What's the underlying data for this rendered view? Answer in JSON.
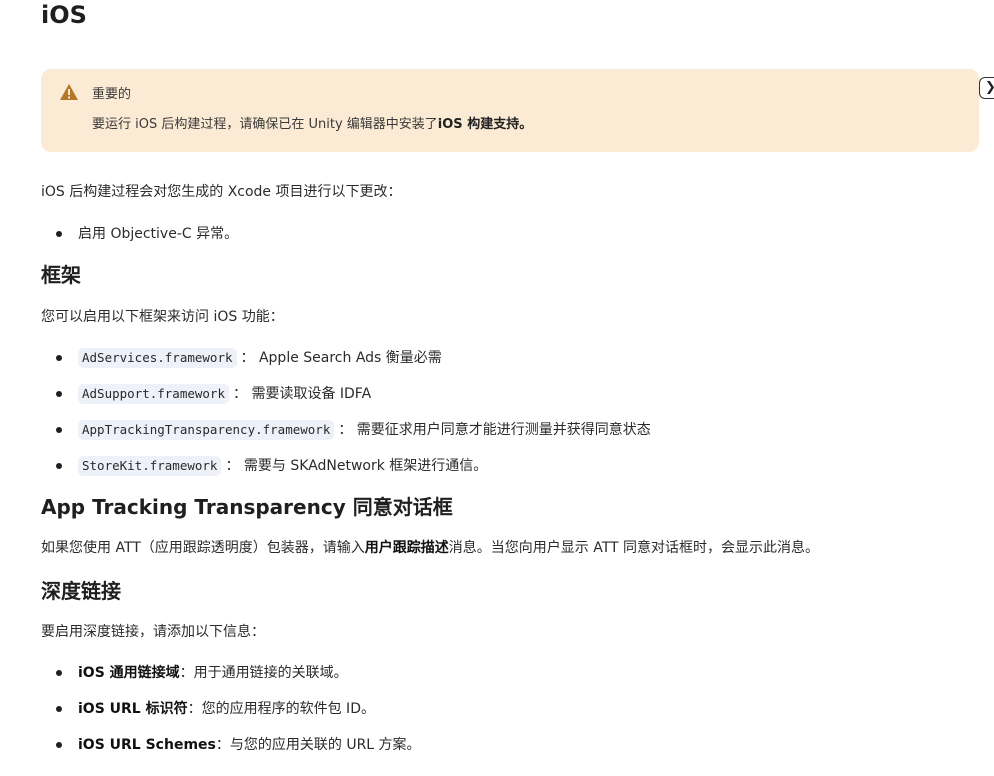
{
  "page": {
    "title": "iOS"
  },
  "callout": {
    "icon": "warning-triangle-icon",
    "heading": "重要的",
    "body_prefix": "要运行 iOS 后构建过程，请确保已在 Unity 编辑器中安装了",
    "body_bold": "iOS 构建支持。"
  },
  "edge_button": {
    "glyph": "❯",
    "icon": "chevron-right-icon"
  },
  "intro": {
    "text": "iOS 后构建过程会对您生成的 Xcode 项目进行以下更改：",
    "items": [
      "启用 Objective-C 异常。"
    ]
  },
  "frameworks": {
    "heading": "框架",
    "intro": "您可以启用以下框架来访问 iOS 功能：",
    "items": [
      {
        "code": "AdServices.framework",
        "desc": "： Apple Search Ads 衡量必需"
      },
      {
        "code": "AdSupport.framework",
        "desc": "： 需要读取设备 IDFA"
      },
      {
        "code": "AppTrackingTransparency.framework",
        "desc": "： 需要征求用户同意才能进行测量并获得同意状态"
      },
      {
        "code": "StoreKit.framework",
        "desc": "： 需要与 SKAdNetwork 框架进行通信。"
      }
    ]
  },
  "att": {
    "heading": "App Tracking Transparency 同意对话框",
    "text_prefix": "如果您使用 ATT（应用跟踪透明度）包装器，请输入",
    "text_bold": "用户跟踪描述",
    "text_suffix": "消息。当您向用户显示 ATT 同意对话框时，会显示此消息。"
  },
  "deeplink": {
    "heading": "深度链接",
    "intro": "要启用深度链接，请添加以下信息：",
    "items": [
      {
        "label": "iOS 通用链接域",
        "desc": "：用于通用链接的关联域。"
      },
      {
        "label": "iOS URL 标识符",
        "desc": "：您的应用程序的软件包 ID。"
      },
      {
        "label": "iOS URL Schemes",
        "desc": "：与您的应用关联的 URL 方案。"
      }
    ]
  },
  "colors": {
    "callout_bg": "#fcebd4",
    "warning_icon": "#b5762a",
    "code_bg": "#eef0fa"
  }
}
